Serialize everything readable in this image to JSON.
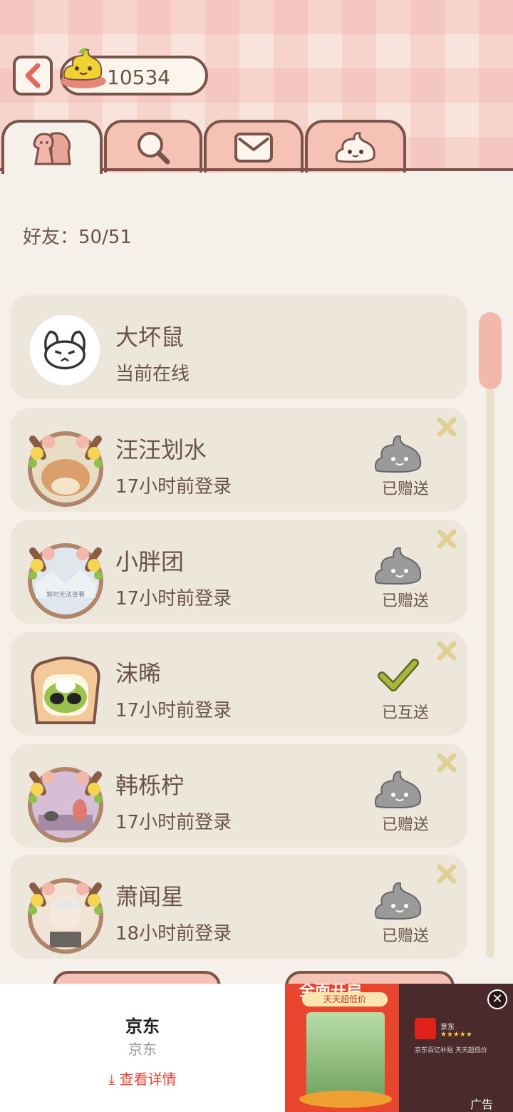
{
  "header": {
    "coin_balance": "10534",
    "tabs": [
      {
        "name": "friends",
        "icon": "friends-icon",
        "active": true
      },
      {
        "name": "search",
        "icon": "search-icon",
        "active": false
      },
      {
        "name": "mail",
        "icon": "mail-icon",
        "active": false
      },
      {
        "name": "gift",
        "icon": "poop-icon",
        "active": false
      }
    ]
  },
  "friends": {
    "count_label": "好友：50/51",
    "list": [
      {
        "name": "大坏鼠",
        "status": "当前在线",
        "gift_label": ""
      },
      {
        "name": "汪汪划水",
        "status": "17小时前登录",
        "gift_label": "已赠送"
      },
      {
        "name": "小胖团",
        "status": "17小时前登录",
        "gift_label": "已赠送",
        "avatar_text": "暂时无法查看"
      },
      {
        "name": "沫晞",
        "status": "17小时前登录",
        "gift_label": "已互送"
      },
      {
        "name": "韩栎柠",
        "status": "17小时前登录",
        "gift_label": "已赠送"
      },
      {
        "name": "萧闻星",
        "status": "18小时前登录",
        "gift_label": "已赠送"
      }
    ]
  },
  "ad": {
    "title": "京东",
    "subtitle": "京东",
    "cta": "查看详情",
    "image_headline": "全面开启",
    "image_banner": "天天超低价",
    "image_brand": "京东",
    "image_tagline": "京东百亿补贴 天天超低价",
    "mark": "广告"
  },
  "colors": {
    "accent": "#7a5448",
    "tab_inactive": "#f6c2b5",
    "card": "#ede6da",
    "check": "#a8b83a",
    "gift_grey": "#9a9a9a"
  }
}
